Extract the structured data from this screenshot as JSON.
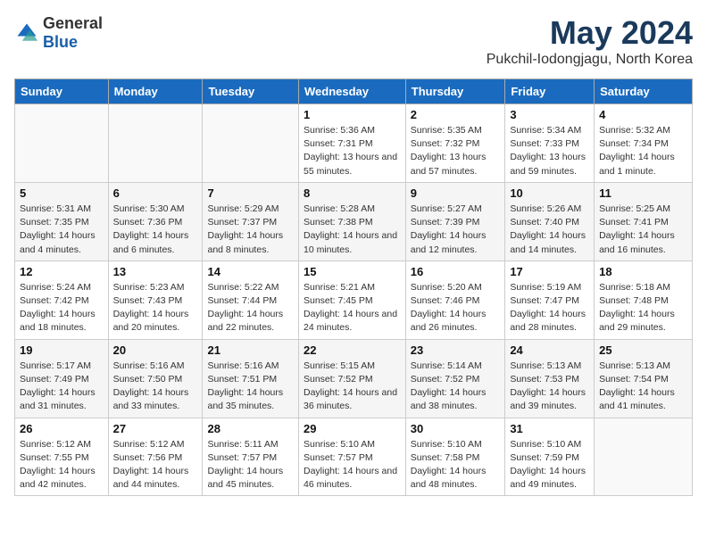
{
  "header": {
    "logo_general": "General",
    "logo_blue": "Blue",
    "title": "May 2024",
    "subtitle": "Pukchil-Iodongjagu, North Korea"
  },
  "weekdays": [
    "Sunday",
    "Monday",
    "Tuesday",
    "Wednesday",
    "Thursday",
    "Friday",
    "Saturday"
  ],
  "weeks": [
    [
      {
        "day": "",
        "sunrise": "",
        "sunset": "",
        "daylight": ""
      },
      {
        "day": "",
        "sunrise": "",
        "sunset": "",
        "daylight": ""
      },
      {
        "day": "",
        "sunrise": "",
        "sunset": "",
        "daylight": ""
      },
      {
        "day": "1",
        "sunrise": "Sunrise: 5:36 AM",
        "sunset": "Sunset: 7:31 PM",
        "daylight": "Daylight: 13 hours and 55 minutes."
      },
      {
        "day": "2",
        "sunrise": "Sunrise: 5:35 AM",
        "sunset": "Sunset: 7:32 PM",
        "daylight": "Daylight: 13 hours and 57 minutes."
      },
      {
        "day": "3",
        "sunrise": "Sunrise: 5:34 AM",
        "sunset": "Sunset: 7:33 PM",
        "daylight": "Daylight: 13 hours and 59 minutes."
      },
      {
        "day": "4",
        "sunrise": "Sunrise: 5:32 AM",
        "sunset": "Sunset: 7:34 PM",
        "daylight": "Daylight: 14 hours and 1 minute."
      }
    ],
    [
      {
        "day": "5",
        "sunrise": "Sunrise: 5:31 AM",
        "sunset": "Sunset: 7:35 PM",
        "daylight": "Daylight: 14 hours and 4 minutes."
      },
      {
        "day": "6",
        "sunrise": "Sunrise: 5:30 AM",
        "sunset": "Sunset: 7:36 PM",
        "daylight": "Daylight: 14 hours and 6 minutes."
      },
      {
        "day": "7",
        "sunrise": "Sunrise: 5:29 AM",
        "sunset": "Sunset: 7:37 PM",
        "daylight": "Daylight: 14 hours and 8 minutes."
      },
      {
        "day": "8",
        "sunrise": "Sunrise: 5:28 AM",
        "sunset": "Sunset: 7:38 PM",
        "daylight": "Daylight: 14 hours and 10 minutes."
      },
      {
        "day": "9",
        "sunrise": "Sunrise: 5:27 AM",
        "sunset": "Sunset: 7:39 PM",
        "daylight": "Daylight: 14 hours and 12 minutes."
      },
      {
        "day": "10",
        "sunrise": "Sunrise: 5:26 AM",
        "sunset": "Sunset: 7:40 PM",
        "daylight": "Daylight: 14 hours and 14 minutes."
      },
      {
        "day": "11",
        "sunrise": "Sunrise: 5:25 AM",
        "sunset": "Sunset: 7:41 PM",
        "daylight": "Daylight: 14 hours and 16 minutes."
      }
    ],
    [
      {
        "day": "12",
        "sunrise": "Sunrise: 5:24 AM",
        "sunset": "Sunset: 7:42 PM",
        "daylight": "Daylight: 14 hours and 18 minutes."
      },
      {
        "day": "13",
        "sunrise": "Sunrise: 5:23 AM",
        "sunset": "Sunset: 7:43 PM",
        "daylight": "Daylight: 14 hours and 20 minutes."
      },
      {
        "day": "14",
        "sunrise": "Sunrise: 5:22 AM",
        "sunset": "Sunset: 7:44 PM",
        "daylight": "Daylight: 14 hours and 22 minutes."
      },
      {
        "day": "15",
        "sunrise": "Sunrise: 5:21 AM",
        "sunset": "Sunset: 7:45 PM",
        "daylight": "Daylight: 14 hours and 24 minutes."
      },
      {
        "day": "16",
        "sunrise": "Sunrise: 5:20 AM",
        "sunset": "Sunset: 7:46 PM",
        "daylight": "Daylight: 14 hours and 26 minutes."
      },
      {
        "day": "17",
        "sunrise": "Sunrise: 5:19 AM",
        "sunset": "Sunset: 7:47 PM",
        "daylight": "Daylight: 14 hours and 28 minutes."
      },
      {
        "day": "18",
        "sunrise": "Sunrise: 5:18 AM",
        "sunset": "Sunset: 7:48 PM",
        "daylight": "Daylight: 14 hours and 29 minutes."
      }
    ],
    [
      {
        "day": "19",
        "sunrise": "Sunrise: 5:17 AM",
        "sunset": "Sunset: 7:49 PM",
        "daylight": "Daylight: 14 hours and 31 minutes."
      },
      {
        "day": "20",
        "sunrise": "Sunrise: 5:16 AM",
        "sunset": "Sunset: 7:50 PM",
        "daylight": "Daylight: 14 hours and 33 minutes."
      },
      {
        "day": "21",
        "sunrise": "Sunrise: 5:16 AM",
        "sunset": "Sunset: 7:51 PM",
        "daylight": "Daylight: 14 hours and 35 minutes."
      },
      {
        "day": "22",
        "sunrise": "Sunrise: 5:15 AM",
        "sunset": "Sunset: 7:52 PM",
        "daylight": "Daylight: 14 hours and 36 minutes."
      },
      {
        "day": "23",
        "sunrise": "Sunrise: 5:14 AM",
        "sunset": "Sunset: 7:52 PM",
        "daylight": "Daylight: 14 hours and 38 minutes."
      },
      {
        "day": "24",
        "sunrise": "Sunrise: 5:13 AM",
        "sunset": "Sunset: 7:53 PM",
        "daylight": "Daylight: 14 hours and 39 minutes."
      },
      {
        "day": "25",
        "sunrise": "Sunrise: 5:13 AM",
        "sunset": "Sunset: 7:54 PM",
        "daylight": "Daylight: 14 hours and 41 minutes."
      }
    ],
    [
      {
        "day": "26",
        "sunrise": "Sunrise: 5:12 AM",
        "sunset": "Sunset: 7:55 PM",
        "daylight": "Daylight: 14 hours and 42 minutes."
      },
      {
        "day": "27",
        "sunrise": "Sunrise: 5:12 AM",
        "sunset": "Sunset: 7:56 PM",
        "daylight": "Daylight: 14 hours and 44 minutes."
      },
      {
        "day": "28",
        "sunrise": "Sunrise: 5:11 AM",
        "sunset": "Sunset: 7:57 PM",
        "daylight": "Daylight: 14 hours and 45 minutes."
      },
      {
        "day": "29",
        "sunrise": "Sunrise: 5:10 AM",
        "sunset": "Sunset: 7:57 PM",
        "daylight": "Daylight: 14 hours and 46 minutes."
      },
      {
        "day": "30",
        "sunrise": "Sunrise: 5:10 AM",
        "sunset": "Sunset: 7:58 PM",
        "daylight": "Daylight: 14 hours and 48 minutes."
      },
      {
        "day": "31",
        "sunrise": "Sunrise: 5:10 AM",
        "sunset": "Sunset: 7:59 PM",
        "daylight": "Daylight: 14 hours and 49 minutes."
      },
      {
        "day": "",
        "sunrise": "",
        "sunset": "",
        "daylight": ""
      }
    ]
  ]
}
